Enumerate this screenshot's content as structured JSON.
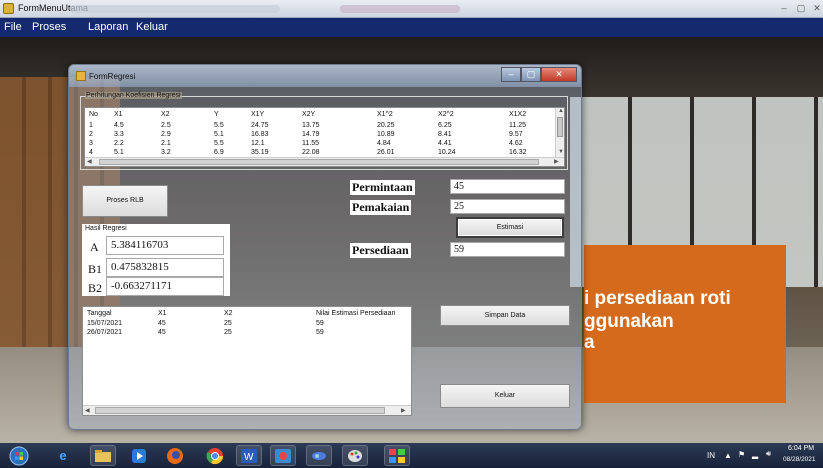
{
  "app": {
    "title": "FormMenuUtama",
    "window_buttons": [
      "–",
      "▢",
      "✕"
    ],
    "menu": [
      "File",
      "Proses",
      "Laporan",
      "Keluar"
    ]
  },
  "background_text": [
    "i persediaan roti",
    "ggunakan",
    "a"
  ],
  "form": {
    "title": "FormRegresi",
    "coef_group_label": "Perhitungan Koefisien Regresi",
    "coef_table": {
      "headers": [
        "No",
        "X1",
        "X2",
        "Y",
        "X1Y",
        "X2Y",
        "X1^2",
        "X2^2",
        "X1X2"
      ],
      "rows": [
        [
          "1",
          "4.5",
          "2.5",
          "5.5",
          "24.75",
          "13.75",
          "20.25",
          "6.25",
          "11.25"
        ],
        [
          "2",
          "3.3",
          "2.9",
          "5.1",
          "16.83",
          "14.79",
          "10.89",
          "8.41",
          "9.57"
        ],
        [
          "3",
          "2.2",
          "2.1",
          "5.5",
          "12.1",
          "11.55",
          "4.84",
          "4.41",
          "4.62"
        ],
        [
          "4",
          "5.1",
          "3.2",
          "6.9",
          "35.19",
          "22.08",
          "26.01",
          "10.24",
          "16.32"
        ]
      ]
    },
    "proses_button": "Proses RLB",
    "hasil_label": "Hasil Regresi",
    "coefficients": [
      {
        "label": "A",
        "value": "5.384116703"
      },
      {
        "label": "B1",
        "value": "0.475832815"
      },
      {
        "label": "B2",
        "value": "-0.663271171"
      }
    ],
    "permintaan_label": "Permintaan",
    "permintaan_value": "45",
    "pemakaian_label": "Pemakaian",
    "pemakaian_value": "25",
    "estimasi_button": "Estimasi",
    "persediaan_label": "Persediaan",
    "persediaan_value": "59",
    "result_table": {
      "headers": [
        "Tanggal",
        "X1",
        "X2",
        "Nilai Estimasi Persediaan"
      ],
      "rows": [
        [
          "15/07/2021",
          "45",
          "25",
          "59"
        ],
        [
          "26/07/2021",
          "45",
          "25",
          "59"
        ]
      ]
    },
    "simpan_button": "Simpan Data",
    "keluar_button": "Keluar"
  },
  "taskbar": {
    "items": [
      "start-orb-icon",
      "ie-icon",
      "explorer-icon",
      "media-player-icon",
      "firefox-icon",
      "chrome-icon",
      "word-icon",
      "app-icon",
      "app2-icon",
      "paint-icon",
      "winforms-icon"
    ],
    "tray_lang": "IN",
    "time": "6:04 PM",
    "date": "08/28/2021"
  }
}
